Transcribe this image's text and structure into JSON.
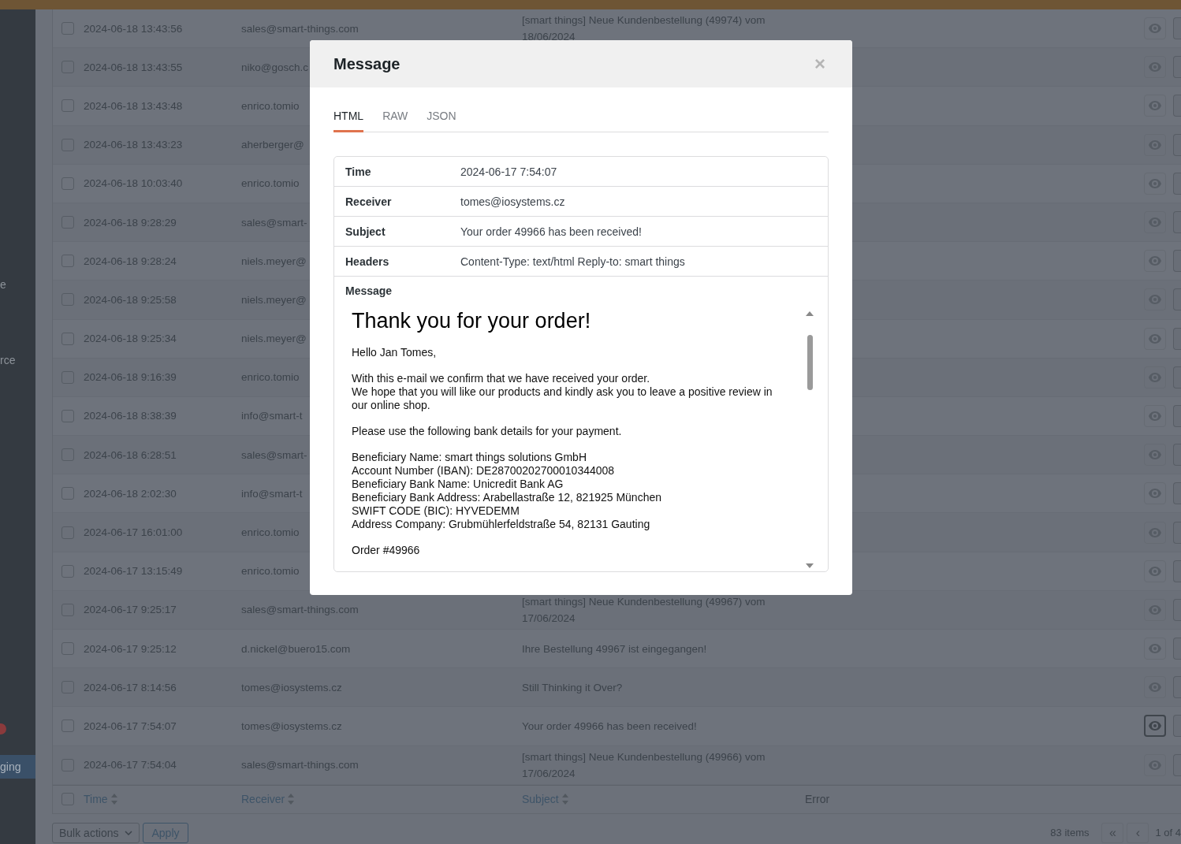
{
  "sidebar": {
    "items": [
      {
        "label": "e",
        "selected": false
      },
      {
        "label": "rce",
        "selected": false
      },
      {
        "label": "ging",
        "selected": true
      }
    ]
  },
  "rows": [
    {
      "time": "2024-06-18 13:43:56",
      "receiver": "sales@smart-things.com",
      "subject": "[smart things] Neue Kundenbestellung (49974) vom 18/06/2024",
      "checked": false,
      "viewing": false
    },
    {
      "time": "2024-06-18 13:43:55",
      "receiver": "niko@gosch.c",
      "checked": false,
      "viewing": false
    },
    {
      "time": "2024-06-18 13:43:48",
      "receiver": "enrico.tomio",
      "checked": false,
      "viewing": false
    },
    {
      "time": "2024-06-18 13:43:23",
      "receiver": "aherberger@",
      "checked": false,
      "viewing": false
    },
    {
      "time": "2024-06-18 10:03:40",
      "receiver": "enrico.tomio",
      "checked": false,
      "viewing": false
    },
    {
      "time": "2024-06-18 9:28:29",
      "receiver": "sales@smart-",
      "checked": false,
      "viewing": false
    },
    {
      "time": "2024-06-18 9:28:24",
      "receiver": "niels.meyer@",
      "checked": false,
      "viewing": false
    },
    {
      "time": "2024-06-18 9:25:58",
      "receiver": "niels.meyer@",
      "checked": false,
      "viewing": false
    },
    {
      "time": "2024-06-18 9:25:34",
      "receiver": "niels.meyer@",
      "checked": false,
      "viewing": false
    },
    {
      "time": "2024-06-18 9:16:39",
      "receiver": "enrico.tomio",
      "checked": false,
      "viewing": false
    },
    {
      "time": "2024-06-18 8:38:39",
      "receiver": "info@smart-t",
      "checked": false,
      "viewing": false
    },
    {
      "time": "2024-06-18 6:28:51",
      "receiver": "sales@smart-",
      "checked": false,
      "viewing": false
    },
    {
      "time": "2024-06-18 2:02:30",
      "receiver": "info@smart-t",
      "checked": false,
      "viewing": false
    },
    {
      "time": "2024-06-17 16:01:00",
      "receiver": "enrico.tomio",
      "checked": false,
      "viewing": false
    },
    {
      "time": "2024-06-17 13:15:49",
      "receiver": "enrico.tomio",
      "checked": false,
      "viewing": false
    },
    {
      "time": "2024-06-17 9:25:17",
      "receiver": "sales@smart-things.com",
      "subject": "[smart things] Neue Kundenbestellung (49967) vom 17/06/2024",
      "checked": false,
      "viewing": false
    },
    {
      "time": "2024-06-17 9:25:12",
      "receiver": "d.nickel@buero15.com",
      "subject": "Ihre Bestellung 49967 ist eingegangen!",
      "checked": false,
      "viewing": false
    },
    {
      "time": "2024-06-17 8:14:56",
      "receiver": "tomes@iosystems.cz",
      "subject": "Still Thinking it Over?",
      "checked": false,
      "viewing": false
    },
    {
      "time": "2024-06-17 7:54:07",
      "receiver": "tomes@iosystems.cz",
      "subject": "Your order 49966 has been received!",
      "checked": false,
      "viewing": true
    },
    {
      "time": "2024-06-17 7:54:04",
      "receiver": "sales@smart-things.com",
      "subject": "[smart things] Neue Kundenbestellung (49966) vom 17/06/2024",
      "checked": false,
      "viewing": false
    }
  ],
  "select_all": {
    "checked": false
  },
  "footer_columns": [
    {
      "label": "Time",
      "sortable": true
    },
    {
      "label": "Receiver",
      "sortable": true
    },
    {
      "label": "Subject",
      "sortable": true
    },
    {
      "label": "Error",
      "sortable": false
    }
  ],
  "bulk_actions": {
    "label": "Bulk actions",
    "apply": "Apply"
  },
  "pagination": {
    "items": "83 items",
    "first": "«",
    "prev": "‹",
    "page": "1 of 4"
  },
  "modal": {
    "title": "Message",
    "close": "×",
    "tabs": [
      {
        "label": "HTML",
        "selected": true
      },
      {
        "label": "RAW",
        "selected": false
      },
      {
        "label": "JSON",
        "selected": false
      }
    ],
    "fields": [
      {
        "label": "Time",
        "value": "2024-06-17 7:54:07"
      },
      {
        "label": "Receiver",
        "value": "tomes@iosystems.cz"
      },
      {
        "label": "Subject",
        "value": "Your order 49966 has been received!"
      },
      {
        "label": "Headers",
        "value": "Content-Type: text/html Reply-to: smart things"
      }
    ],
    "message_label": "Message",
    "message": {
      "heading": "Thank you for your order!",
      "paragraphs": [
        [
          "Hello Jan Tomes,"
        ],
        [
          "With this e-mail we confirm that we have received your order.",
          "We hope that you will like our products and kindly ask you to leave a positive review in our online shop."
        ],
        [
          "Please use the following bank details for your payment."
        ],
        [
          "Beneficiary Name: smart things solutions GmbH",
          "Account Number (IBAN): DE28700202700010344008",
          "Beneficiary Bank Name: Unicredit Bank AG",
          "Beneficiary Bank Address: Arabellastraße 12, 821925 München",
          "SWIFT CODE (BIC): HYVEDEMM",
          "Address Company: Grubmühlerfeldstraße 54, 82131 Gauting"
        ],
        [
          "Order #49966"
        ]
      ]
    }
  }
}
